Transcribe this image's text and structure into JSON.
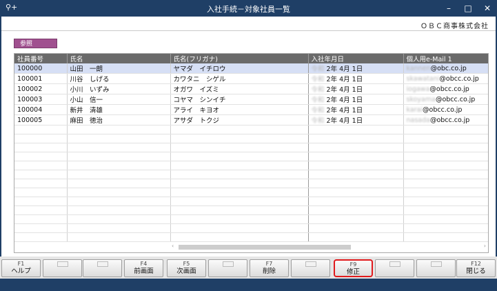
{
  "window": {
    "title": "入社手続－対象社員一覧",
    "icon": "search-plus-icon",
    "controls": {
      "minimize": "–",
      "maximize": "□",
      "close": "✕"
    }
  },
  "company": "ＯＢＣ商事株式会社",
  "mode_badge": "参照",
  "table": {
    "columns": [
      "社員番号",
      "氏名",
      "氏名(フリガナ)",
      "入社年月日",
      "個人用e-Mail 1"
    ],
    "rows": [
      {
        "id": "100000",
        "name": "山田　一朗",
        "kana": "ヤマダ　イチロウ",
        "era": "令和",
        "date": "2年  4月  1日",
        "mail_user": "kannen",
        "mail_domain": "@obc.co.jp"
      },
      {
        "id": "100001",
        "name": "川谷　しげる",
        "kana": "カワタニ　シゲル",
        "era": "令和",
        "date": "2年  4月  1日",
        "mail_user": "skawatani",
        "mail_domain": "@obcc.co.jp"
      },
      {
        "id": "100002",
        "name": "小川　いずみ",
        "kana": "オガワ　イズミ",
        "era": "令和",
        "date": "2年  4月  1日",
        "mail_user": "iogawa",
        "mail_domain": "@obcc.co.jp"
      },
      {
        "id": "100003",
        "name": "小山　信一",
        "kana": "コヤマ　シンイチ",
        "era": "令和",
        "date": "2年  4月  1日",
        "mail_user": "skoyama",
        "mail_domain": "@obcc.co.jp"
      },
      {
        "id": "100004",
        "name": "新井　清雄",
        "kana": "アライ　キヨオ",
        "era": "令和",
        "date": "2年  4月  1日",
        "mail_user": "karai",
        "mail_domain": "@obcc.co.jp"
      },
      {
        "id": "100005",
        "name": "麻田　徳治",
        "kana": "アサダ　トクジ",
        "era": "令和",
        "date": "2年  4月  1日",
        "mail_user": "nasada",
        "mail_domain": "@obcc.co.jp"
      }
    ],
    "empty_rows": 13
  },
  "scrollbar": {
    "left_arrow": "‹",
    "right_arrow": "›"
  },
  "function_keys": [
    {
      "key": "F1",
      "label": "ヘルプ",
      "enabled": true
    },
    {
      "key": "",
      "label": "",
      "enabled": false
    },
    {
      "key": "",
      "label": "",
      "enabled": false
    },
    {
      "key": "F4",
      "label": "前画面",
      "enabled": true
    },
    {
      "key": "F5",
      "label": "次画面",
      "enabled": true
    },
    {
      "key": "",
      "label": "",
      "enabled": false
    },
    {
      "key": "F7",
      "label": "削除",
      "enabled": true
    },
    {
      "key": "",
      "label": "",
      "enabled": false
    },
    {
      "key": "F9",
      "label": "修正",
      "enabled": true,
      "highlighted": true
    },
    {
      "key": "",
      "label": "",
      "enabled": false
    },
    {
      "key": "",
      "label": "",
      "enabled": false
    },
    {
      "key": "F12",
      "label": "閉じる",
      "enabled": true
    }
  ],
  "colors": {
    "frame": "#1f3f66",
    "header": "#6a6a6a",
    "badge": "#a0508f",
    "selection": "#d6dff5",
    "highlight": "#e0191c"
  }
}
